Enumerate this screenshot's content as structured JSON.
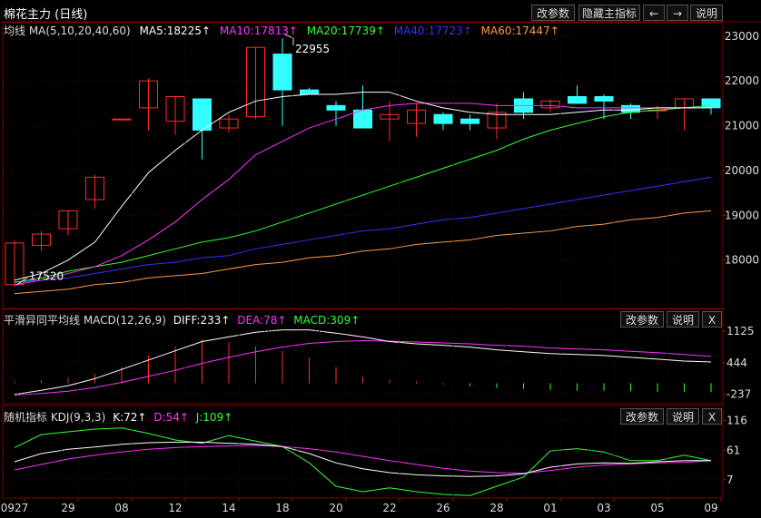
{
  "header": {
    "title": "棉花主力 (日线)",
    "buttons": [
      "改参数",
      "隐藏主指标",
      "←",
      "→",
      "说明"
    ]
  },
  "ma_panel": {
    "label": "均线 MA(5,10,20,40,60)",
    "items": [
      {
        "text": "MA5:18225↑",
        "color": "#ffffff"
      },
      {
        "text": "MA10:17813↑",
        "color": "#ff33ff"
      },
      {
        "text": "MA20:17739↑",
        "color": "#33ff33"
      },
      {
        "text": "MA40:17723↑",
        "color": "#3333ff"
      },
      {
        "text": "MA60:17447↑",
        "color": "#ff9944"
      }
    ]
  },
  "macd_panel": {
    "label": "平滑异同平均线 MACD(12,26,9)",
    "items": [
      {
        "text": "DIFF:233↑",
        "color": "#ffffff"
      },
      {
        "text": "DEA:78↑",
        "color": "#ff33ff"
      },
      {
        "text": "MACD:309↑",
        "color": "#33ff33"
      }
    ],
    "buttons": [
      "改参数",
      "说明",
      "X"
    ]
  },
  "kdj_panel": {
    "label": "随机指标 KDJ(9,3,3)",
    "items": [
      {
        "text": "K:72↑",
        "color": "#ffffff"
      },
      {
        "text": "D:54↑",
        "color": "#ff33ff"
      },
      {
        "text": "J:109↑",
        "color": "#33ff33"
      }
    ],
    "buttons": [
      "改参数",
      "说明",
      "X"
    ]
  },
  "chart_data": {
    "type": "candlestick",
    "x_labels": [
      "0927",
      "29",
      "08",
      "12",
      "14",
      "18",
      "20",
      "22",
      "26",
      "28",
      "01",
      "03",
      "05",
      "09"
    ],
    "price_ticks": [
      23000,
      22000,
      21000,
      20000,
      19000,
      18000
    ],
    "macd_ticks": [
      "1125",
      "444",
      "-237"
    ],
    "kdj_ticks": [
      "116",
      "61",
      "7"
    ],
    "annotations": {
      "high": "22955",
      "low": "17520"
    },
    "candles": [
      {
        "o": 17450,
        "h": 18450,
        "l": 17400,
        "c": 18380
      },
      {
        "o": 18330,
        "h": 18650,
        "l": 18200,
        "c": 18580
      },
      {
        "o": 18700,
        "h": 19100,
        "l": 18550,
        "c": 19100
      },
      {
        "o": 19350,
        "h": 19900,
        "l": 19150,
        "c": 19850
      },
      {
        "o": 21150,
        "h": 21150,
        "l": 21150,
        "c": 21150
      },
      {
        "o": 21400,
        "h": 22050,
        "l": 20900,
        "c": 22000
      },
      {
        "o": 21100,
        "h": 21650,
        "l": 20800,
        "c": 21650
      },
      {
        "o": 21600,
        "h": 21600,
        "l": 20250,
        "c": 20900
      },
      {
        "o": 20950,
        "h": 21250,
        "l": 20850,
        "c": 21150
      },
      {
        "o": 21200,
        "h": 22750,
        "l": 21150,
        "c": 22750
      },
      {
        "o": 22600,
        "h": 22955,
        "l": 21000,
        "c": 21800
      },
      {
        "o": 21800,
        "h": 21850,
        "l": 21700,
        "c": 21700
      },
      {
        "o": 21450,
        "h": 21550,
        "l": 21000,
        "c": 21350
      },
      {
        "o": 21350,
        "h": 21900,
        "l": 20950,
        "c": 20950
      },
      {
        "o": 21150,
        "h": 21550,
        "l": 20650,
        "c": 21250
      },
      {
        "o": 21050,
        "h": 21500,
        "l": 20750,
        "c": 21350
      },
      {
        "o": 21250,
        "h": 21300,
        "l": 20900,
        "c": 21050
      },
      {
        "o": 21150,
        "h": 21250,
        "l": 20900,
        "c": 21050
      },
      {
        "o": 20950,
        "h": 21500,
        "l": 20700,
        "c": 21300
      },
      {
        "o": 21600,
        "h": 21750,
        "l": 21150,
        "c": 21300
      },
      {
        "o": 21400,
        "h": 21600,
        "l": 21300,
        "c": 21550
      },
      {
        "o": 21650,
        "h": 21900,
        "l": 21500,
        "c": 21500
      },
      {
        "o": 21650,
        "h": 21700,
        "l": 21150,
        "c": 21550
      },
      {
        "o": 21450,
        "h": 21500,
        "l": 21150,
        "c": 21300
      },
      {
        "o": 21350,
        "h": 21450,
        "l": 21150,
        "c": 21350
      },
      {
        "o": 21400,
        "h": 21600,
        "l": 20900,
        "c": 21600
      },
      {
        "o": 21600,
        "h": 21600,
        "l": 21250,
        "c": 21400
      }
    ],
    "ma5": [
      17550,
      17700,
      18000,
      18400,
      19200,
      19950,
      20450,
      20900,
      21300,
      21550,
      21650,
      21700,
      21700,
      21750,
      21750,
      21550,
      21400,
      21300,
      21250,
      21250,
      21250,
      21300,
      21350,
      21350,
      21400,
      21400,
      21400
    ],
    "ma10": [
      17450,
      17550,
      17700,
      17850,
      18100,
      18450,
      18850,
      19350,
      19800,
      20350,
      20650,
      20950,
      21150,
      21350,
      21450,
      21500,
      21500,
      21500,
      21450,
      21450,
      21450,
      21400,
      21400,
      21400,
      21400,
      21400,
      21400
    ],
    "ma20": [
      17500,
      17600,
      17750,
      17850,
      17950,
      18100,
      18250,
      18400,
      18500,
      18650,
      18850,
      19050,
      19250,
      19450,
      19650,
      19850,
      20050,
      20250,
      20450,
      20700,
      20900,
      21050,
      21200,
      21300,
      21350,
      21400,
      21450
    ],
    "ma40": [
      17500,
      17550,
      17600,
      17700,
      17800,
      17900,
      17950,
      18050,
      18100,
      18250,
      18350,
      18450,
      18550,
      18650,
      18700,
      18800,
      18900,
      18950,
      19050,
      19150,
      19250,
      19350,
      19450,
      19550,
      19650,
      19750,
      19850
    ],
    "ma60": [
      17250,
      17300,
      17350,
      17450,
      17500,
      17600,
      17650,
      17700,
      17800,
      17900,
      17950,
      18050,
      18100,
      18200,
      18250,
      18350,
      18400,
      18450,
      18550,
      18600,
      18650,
      18750,
      18800,
      18900,
      18950,
      19050,
      19100
    ],
    "macd": {
      "diff": [
        -240,
        -150,
        -50,
        100,
        300,
        500,
        700,
        900,
        1000,
        1100,
        1150,
        1150,
        1080,
        1000,
        900,
        850,
        820,
        780,
        720,
        680,
        640,
        620,
        600,
        560,
        520,
        480,
        460
      ],
      "dea": [
        -250,
        -220,
        -170,
        -90,
        20,
        150,
        280,
        430,
        560,
        680,
        780,
        860,
        900,
        920,
        910,
        890,
        870,
        850,
        820,
        800,
        760,
        740,
        720,
        690,
        660,
        620,
        580
      ],
      "hist": [
        40,
        70,
        120,
        200,
        350,
        600,
        800,
        950,
        880,
        800,
        700,
        550,
        350,
        150,
        80,
        40,
        -20,
        -60,
        -100,
        -120,
        -140,
        -160,
        -160,
        -170,
        -180,
        -180,
        -190
      ]
    },
    "kdj": {
      "k": [
        40,
        55,
        63,
        67,
        72,
        75,
        76,
        76,
        74,
        72,
        68,
        55,
        38,
        27,
        20,
        16,
        14,
        13,
        14,
        18,
        30,
        36,
        38,
        37,
        40,
        42,
        42
      ],
      "d": [
        25,
        35,
        45,
        52,
        58,
        63,
        66,
        68,
        69,
        70,
        68,
        64,
        58,
        50,
        42,
        35,
        28,
        23,
        20,
        19,
        24,
        30,
        34,
        36,
        38,
        39,
        42
      ],
      "j": [
        66,
        90,
        95,
        100,
        102,
        92,
        80,
        74,
        88,
        78,
        68,
        38,
        -5,
        -15,
        -8,
        -15,
        -20,
        -22,
        -5,
        12,
        60,
        64,
        58,
        42,
        42,
        52,
        42
      ]
    }
  }
}
